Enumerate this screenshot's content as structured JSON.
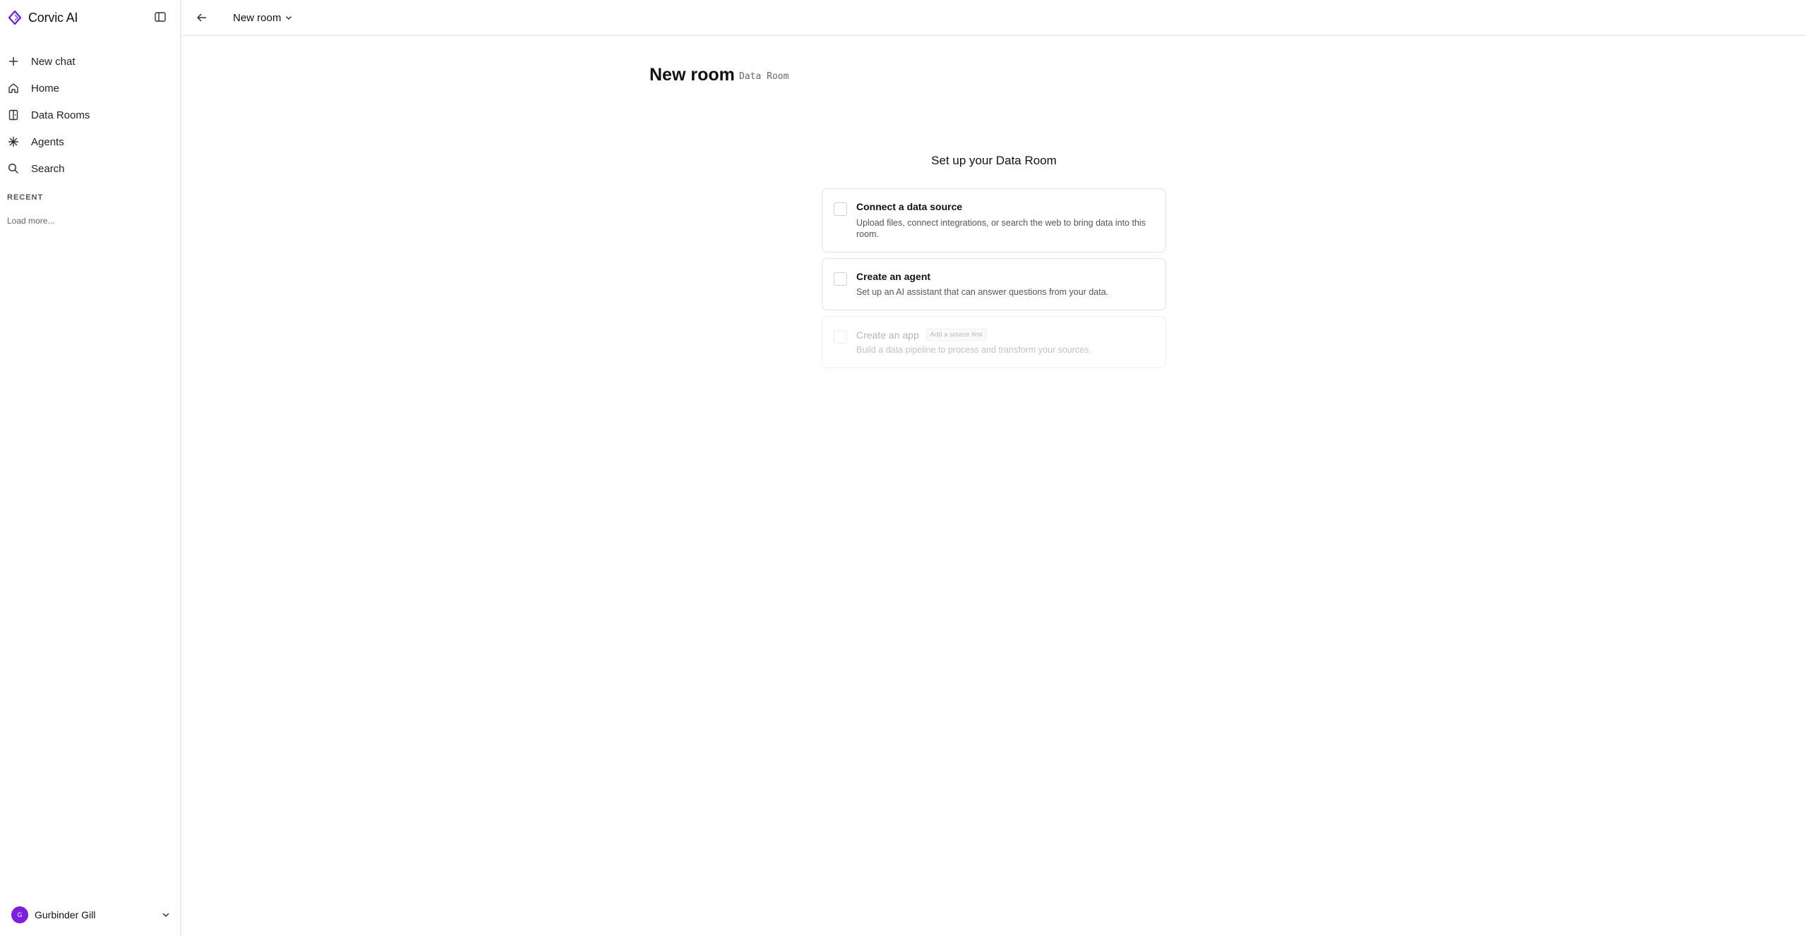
{
  "brand": {
    "name": "Corvic AI",
    "logo_icon": "corvic-logo-icon",
    "accent": "#7c1fe0"
  },
  "sidebar": {
    "items": [
      {
        "label": "New chat",
        "icon": "plus-icon"
      },
      {
        "label": "Home",
        "icon": "home-icon"
      },
      {
        "label": "Data Rooms",
        "icon": "data-rooms-icon"
      },
      {
        "label": "Agents",
        "icon": "asterisk-icon"
      },
      {
        "label": "Search",
        "icon": "search-icon"
      }
    ],
    "recent_title": "RECENT",
    "load_more": "Load more..."
  },
  "user": {
    "initial": "G",
    "name": "Gurbinder Gill",
    "avatar_color": "#7c1fe0"
  },
  "topbar": {
    "room_name": "New room"
  },
  "page": {
    "title": "New room",
    "subtitle": "Data Room"
  },
  "setup": {
    "title": "Set up your Data Room",
    "cards": [
      {
        "title": "Connect a data source",
        "description": "Upload files, connect integrations, or search the web to bring data into this room.",
        "enabled": true
      },
      {
        "title": "Create an agent",
        "description": "Set up an AI assistant that can answer questions from your data.",
        "enabled": true
      },
      {
        "title": "Create an app",
        "badge": "Add a source first",
        "description": "Build a data pipeline to process and transform your sources.",
        "enabled": false
      }
    ]
  }
}
